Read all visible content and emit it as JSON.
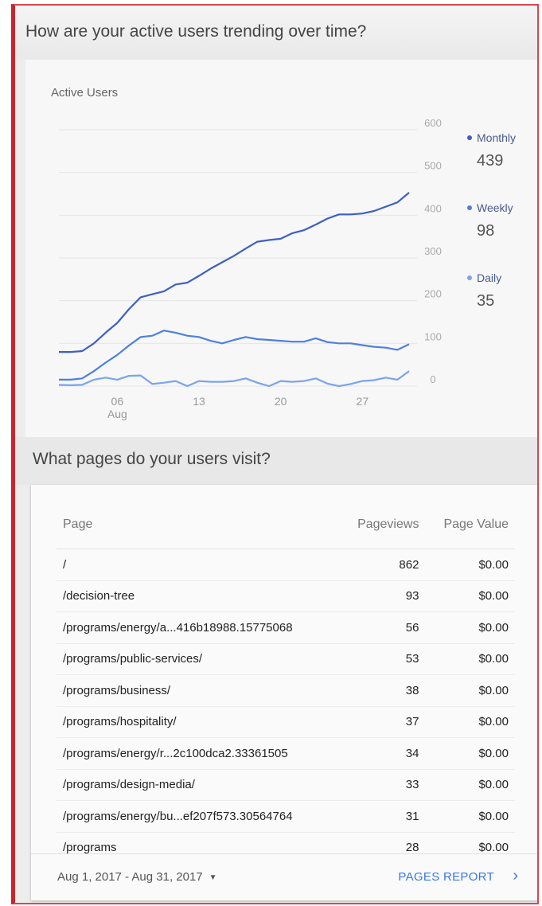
{
  "section1": {
    "title": "How are your active users trending over time?"
  },
  "chart": {
    "title": "Active Users"
  },
  "legend": [
    {
      "label": "Monthly",
      "value": "439",
      "color": "#3e5fc5"
    },
    {
      "label": "Weekly",
      "value": "98",
      "color": "#4f7fe0"
    },
    {
      "label": "Daily",
      "value": "35",
      "color": "#7aa3f0"
    }
  ],
  "chart_data": {
    "type": "line",
    "title": "Active Users",
    "xlabel": "",
    "ylabel": "",
    "ylim": [
      0,
      600
    ],
    "y_ticks": [
      "0",
      "100",
      "200",
      "300",
      "400",
      "500",
      "600"
    ],
    "x_ticks": [
      {
        "label": "06",
        "sublabel": "Aug",
        "day": 6
      },
      {
        "label": "13",
        "sublabel": "",
        "day": 13
      },
      {
        "label": "20",
        "sublabel": "",
        "day": 20
      },
      {
        "label": "27",
        "sublabel": "",
        "day": 27
      }
    ],
    "x": [
      1,
      2,
      3,
      4,
      5,
      6,
      7,
      8,
      9,
      10,
      11,
      12,
      13,
      14,
      15,
      16,
      17,
      18,
      19,
      20,
      21,
      22,
      23,
      24,
      25,
      26,
      27,
      28,
      29,
      30,
      31
    ],
    "series": [
      {
        "name": "Monthly",
        "color": "#3e5fc5",
        "values": [
          80,
          80,
          82,
          100,
          125,
          148,
          180,
          208,
          215,
          222,
          238,
          242,
          258,
          275,
          290,
          305,
          322,
          338,
          342,
          345,
          358,
          365,
          378,
          392,
          402,
          402,
          404,
          410,
          420,
          430,
          453
        ]
      },
      {
        "name": "Weekly",
        "color": "#4f7fe0",
        "values": [
          15,
          15,
          18,
          35,
          55,
          73,
          95,
          115,
          118,
          130,
          125,
          118,
          115,
          106,
          100,
          108,
          115,
          110,
          108,
          106,
          104,
          104,
          112,
          103,
          100,
          100,
          96,
          92,
          90,
          85,
          98
        ]
      },
      {
        "name": "Daily",
        "color": "#7aa3f0",
        "values": [
          3,
          2,
          3,
          15,
          20,
          15,
          24,
          25,
          5,
          8,
          12,
          0,
          12,
          10,
          10,
          12,
          18,
          8,
          0,
          12,
          10,
          12,
          18,
          6,
          0,
          5,
          12,
          14,
          20,
          15,
          35
        ]
      }
    ]
  },
  "section2": {
    "title": "What pages do your users visit?"
  },
  "table": {
    "headers": {
      "page": "Page",
      "pageviews": "Pageviews",
      "value": "Page Value"
    },
    "rows": [
      {
        "page": "/",
        "pageviews": "862",
        "value": "$0.00"
      },
      {
        "page": "/decision-tree",
        "pageviews": "93",
        "value": "$0.00"
      },
      {
        "page": "/programs/energy/a...416b18988.15775068",
        "pageviews": "56",
        "value": "$0.00"
      },
      {
        "page": "/programs/public-services/",
        "pageviews": "53",
        "value": "$0.00"
      },
      {
        "page": "/programs/business/",
        "pageviews": "38",
        "value": "$0.00"
      },
      {
        "page": "/programs/hospitality/",
        "pageviews": "37",
        "value": "$0.00"
      },
      {
        "page": "/programs/energy/r...2c100dca2.33361505",
        "pageviews": "34",
        "value": "$0.00"
      },
      {
        "page": "/programs/design-media/",
        "pageviews": "33",
        "value": "$0.00"
      },
      {
        "page": "/programs/energy/bu...ef207f573.30564764",
        "pageviews": "31",
        "value": "$0.00"
      },
      {
        "page": "/programs",
        "pageviews": "28",
        "value": "$0.00"
      }
    ]
  },
  "footer": {
    "date_range": "Aug 1, 2017 - Aug 31, 2017",
    "report_link": "PAGES REPORT"
  }
}
